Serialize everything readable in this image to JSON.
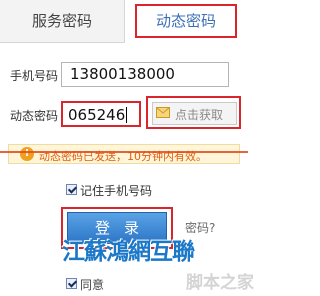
{
  "tabs": {
    "service": "服务密码",
    "dynamic": "动态密码"
  },
  "form": {
    "phone_label": "手机号码",
    "phone_value": "13800138000",
    "code_label": "动态密码",
    "code_value": "065246",
    "get_code_label": "点击获取"
  },
  "notice": {
    "message": "动态密码已发送，10分钟内有效。"
  },
  "remember": {
    "label": "记住手机号码"
  },
  "login": {
    "label": "登录",
    "forgot_label": "密码?"
  },
  "agree": {
    "label": "同意"
  },
  "watermarks": {
    "primary": "江蘇鴻網互聯",
    "secondary": "脚本之家"
  },
  "colors": {
    "highlight": "#d9262c",
    "accent": "#3b6fb6",
    "button": "#2c76c8",
    "notice_text": "#e06010"
  }
}
